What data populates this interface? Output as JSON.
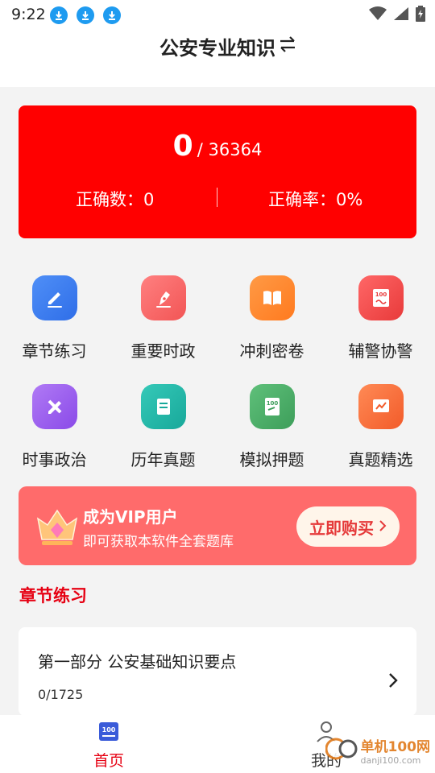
{
  "status_bar": {
    "time": "9:22"
  },
  "header": {
    "title": "公安专业知识",
    "switch_icon": "swap-icon"
  },
  "score": {
    "correct_total": "0",
    "total_questions": "/ 36364",
    "correct_count_label": "正确数：0",
    "accuracy_label": "正确率：0%"
  },
  "categories": [
    {
      "label": "章节练习",
      "icon": "pencil-icon",
      "color": "#3a7bf0"
    },
    {
      "label": "重要时政",
      "icon": "pen-nib-icon",
      "color": "#ff6b6b"
    },
    {
      "label": "冲刺密卷",
      "icon": "book-icon",
      "color": "#ff8533"
    },
    {
      "label": "辅警协警",
      "icon": "score-100-icon",
      "color": "#f24e4e"
    },
    {
      "label": "时事政治",
      "icon": "pencil-ruler-icon",
      "color": "#9b5cf0"
    },
    {
      "label": "历年真题",
      "icon": "document-icon",
      "color": "#1fb8a8"
    },
    {
      "label": "模拟押题",
      "icon": "exam-paper-icon",
      "color": "#4caf6a"
    },
    {
      "label": "真题精选",
      "icon": "chart-board-icon",
      "color": "#ff6a3d"
    }
  ],
  "vip": {
    "title": "成为VIP用户",
    "subtitle": "即可获取本软件全套题库",
    "button": "立即购买"
  },
  "section": {
    "title": "章节练习"
  },
  "chapter": {
    "title": "第一部分 公安基础知识要点",
    "progress": "0/1725"
  },
  "tabs": {
    "home": "首页",
    "mine": "我的"
  },
  "watermark": {
    "brand": "单机100网",
    "url": "danji100.com"
  },
  "colors": {
    "accent": "#e60012",
    "score_bg": "#ff0000",
    "vip_bg": "#ff6b6b"
  }
}
